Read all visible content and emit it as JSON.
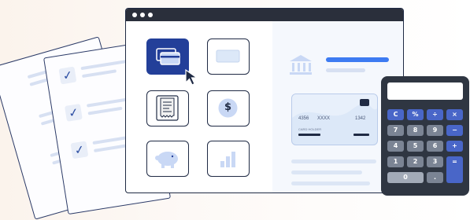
{
  "colors": {
    "primary": "#233f99",
    "accent_blue": "#3d7bf2",
    "dark": "#1f2a44",
    "card_bg": "#dce8f8"
  },
  "checklist": {
    "items": [
      "✓",
      "✓",
      "✓"
    ]
  },
  "tiles": [
    {
      "name": "cards-icon",
      "active": true
    },
    {
      "name": "card-icon",
      "active": false
    },
    {
      "name": "receipt-icon",
      "active": false
    },
    {
      "name": "dollar-coin-icon",
      "active": false,
      "symbol": "$"
    },
    {
      "name": "piggy-bank-icon",
      "active": false
    },
    {
      "name": "bar-chart-icon",
      "active": false
    }
  ],
  "card": {
    "number_left": "4356",
    "number_mid": "XXXX",
    "number_right": "1342",
    "holder": "CARD HOLDER"
  },
  "calculator": {
    "keys": [
      {
        "label": "C",
        "style": "blue"
      },
      {
        "label": "%",
        "style": "blue"
      },
      {
        "label": "÷",
        "style": "blue"
      },
      {
        "label": "×",
        "style": "blue"
      },
      {
        "label": "7",
        "style": "grey"
      },
      {
        "label": "8",
        "style": "grey"
      },
      {
        "label": "9",
        "style": "grey"
      },
      {
        "label": "−",
        "style": "blue"
      },
      {
        "label": "4",
        "style": "grey"
      },
      {
        "label": "5",
        "style": "grey"
      },
      {
        "label": "6",
        "style": "grey"
      },
      {
        "label": "+",
        "style": "blue"
      },
      {
        "label": "1",
        "style": "grey"
      },
      {
        "label": "2",
        "style": "grey"
      },
      {
        "label": "3",
        "style": "grey"
      },
      {
        "label": "=",
        "style": "blue"
      },
      {
        "label": "0",
        "style": "light"
      },
      {
        "label": ".",
        "style": "grey"
      }
    ]
  }
}
